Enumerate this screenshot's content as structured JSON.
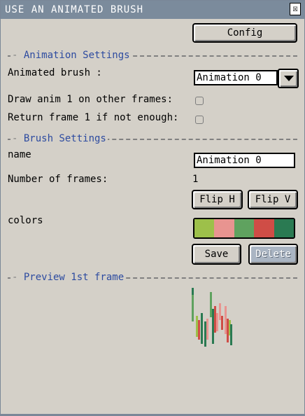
{
  "window": {
    "title": "USE AN ANIMATED BRUSH",
    "close_glyph": "☒"
  },
  "toolbar": {
    "config_label": "Config"
  },
  "animation_settings": {
    "section_title": "Animation Settings",
    "animated_brush_label": "Animated brush :",
    "animated_brush_value": "Animation 0",
    "draw_anim_label": "Draw anim 1 on other frames:",
    "draw_anim_checked": false,
    "return_frame_label": "Return frame 1 if not enough:",
    "return_frame_checked": false
  },
  "brush_settings": {
    "section_title": "Brush Settings",
    "name_label": "name",
    "name_value": "Animation 0",
    "frames_label": "Number of frames:",
    "frames_value": "1",
    "flip_h_label": "Flip H",
    "flip_v_label": "Flip V",
    "colors_label": "colors",
    "colors": [
      "#9dc04a",
      "#e89490",
      "#5fa25f",
      "#cf4d46",
      "#2a7a52"
    ],
    "save_label": "Save",
    "delete_label": "Delete"
  },
  "preview": {
    "section_title": "Preview 1st frame"
  },
  "theme": {
    "title_bar": "#7b8b9c",
    "section_text": "#2d4ba0",
    "background": "#d4d0c8"
  }
}
